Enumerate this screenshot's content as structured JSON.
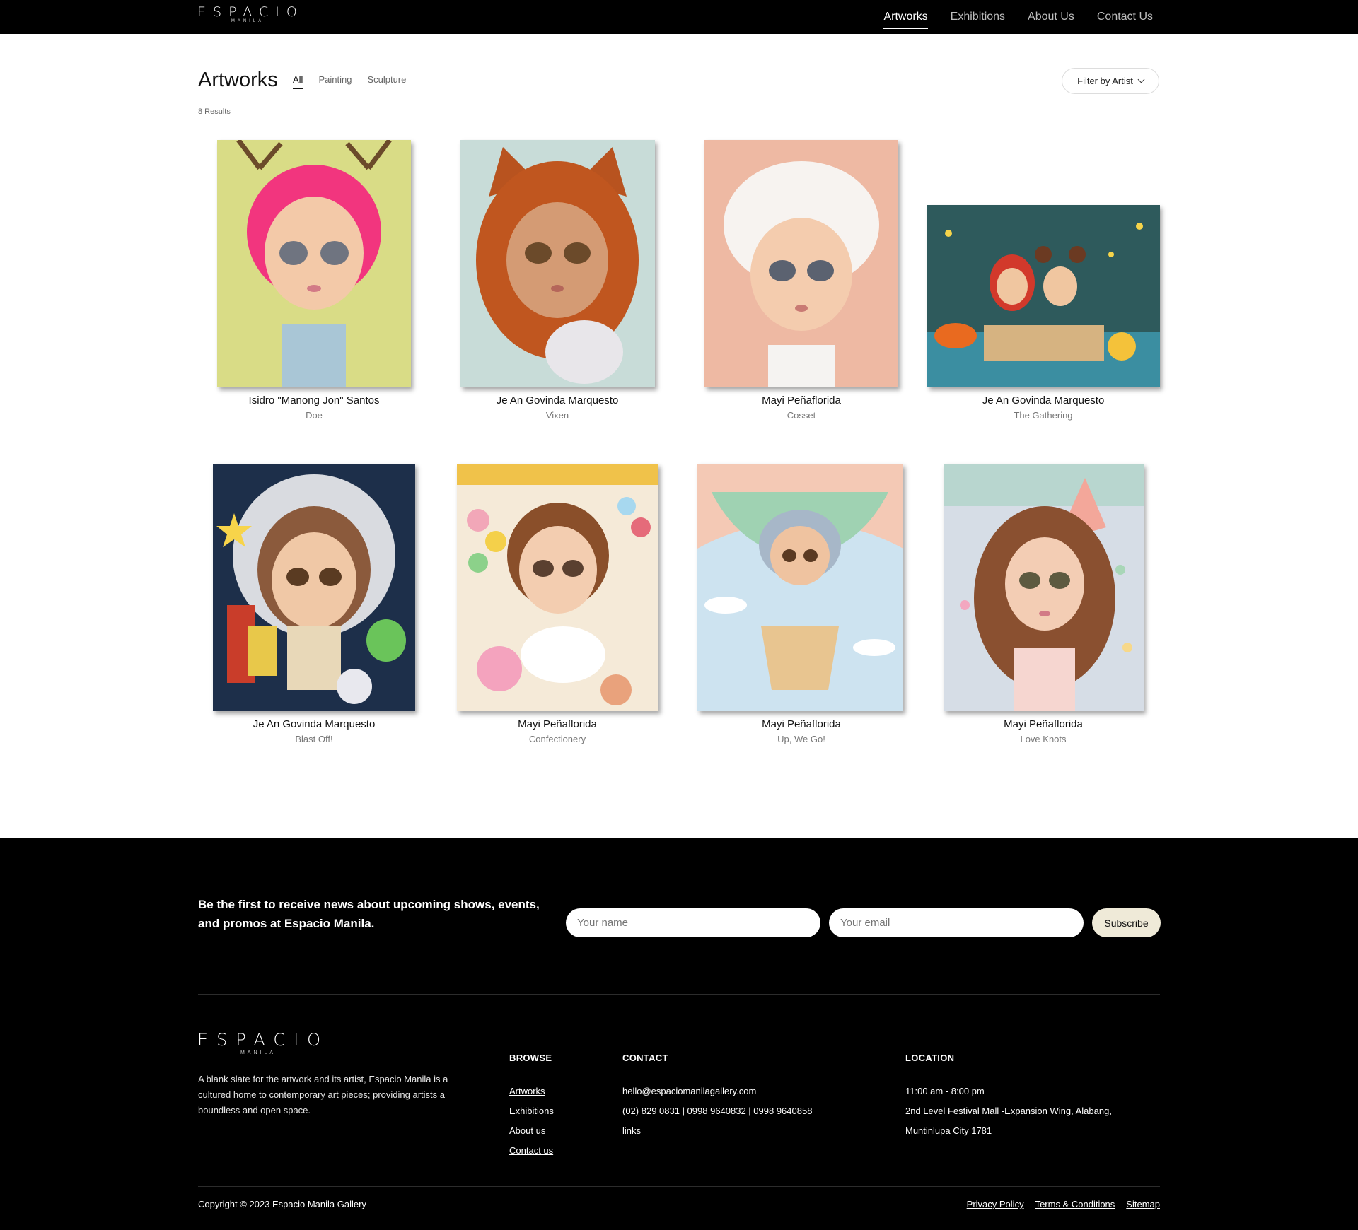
{
  "brand": {
    "name": "ESPACIO",
    "sub": "MANILA"
  },
  "nav": {
    "items": [
      {
        "label": "Artworks"
      },
      {
        "label": "Exhibitions"
      },
      {
        "label": "About Us"
      },
      {
        "label": "Contact Us"
      }
    ]
  },
  "page": {
    "title": "Artworks",
    "tabs": [
      {
        "label": "All"
      },
      {
        "label": "Painting"
      },
      {
        "label": "Sculpture"
      }
    ],
    "results": "8 Results",
    "filter_label": "Filter by Artist"
  },
  "artworks": [
    {
      "artist": "Isidro \"Manong Jon\" Santos",
      "title": "Doe"
    },
    {
      "artist": "Je An Govinda Marquesto",
      "title": "Vixen"
    },
    {
      "artist": "Mayi Peñaflorida",
      "title": "Cosset"
    },
    {
      "artist": "Je An Govinda Marquesto",
      "title": "The Gathering"
    },
    {
      "artist": "Je An Govinda Marquesto",
      "title": "Blast Off!"
    },
    {
      "artist": "Mayi Peñaflorida",
      "title": "Confectionery"
    },
    {
      "artist": "Mayi Peñaflorida",
      "title": "Up, We Go!"
    },
    {
      "artist": "Mayi Peñaflorida",
      "title": "Love Knots"
    }
  ],
  "footer": {
    "newsletter": "Be the first to receive news about upcoming shows, events, and promos at Espacio Manila.",
    "name_placeholder": "Your name",
    "email_placeholder": "Your email",
    "subscribe_label": "Subscribe",
    "about": "A blank slate for the artwork and its artist, Espacio Manila is a cultured home to contemporary art pieces; providing artists a boundless and open space.",
    "browse": {
      "heading": "BROWSE",
      "links": [
        "Artworks",
        "Exhibitions",
        "About us",
        "Contact us"
      ]
    },
    "contact": {
      "heading": "CONTACT",
      "lines": [
        "hello@espaciomanilagallery.com",
        "(02) 829 0831 | 0998 9640832 | 0998 9640858",
        "links"
      ]
    },
    "location": {
      "heading": "LOCATION",
      "lines": [
        "11:00 am - 8:00 pm",
        "2nd Level Festival Mall -Expansion Wing, Alabang,",
        "Muntinlupa City 1781"
      ]
    },
    "copyright": "Copyright © 2023 Espacio Manila Gallery",
    "legal": [
      "Privacy Policy",
      "Terms & Conditions",
      "Sitemap"
    ]
  }
}
